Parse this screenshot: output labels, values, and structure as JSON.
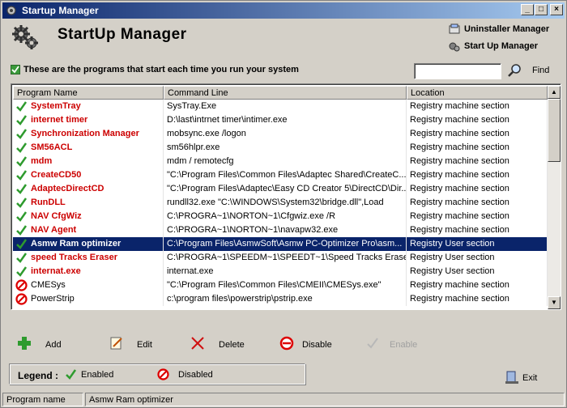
{
  "window": {
    "title": "Startup Manager"
  },
  "titlebar": {
    "minimize": "_",
    "maximize": "□",
    "close": "×"
  },
  "header": {
    "title": "StartUp Manager"
  },
  "nav": {
    "uninstaller": "Uninstaller Manager",
    "startup": "Start Up Manager"
  },
  "info": {
    "text": "These are the programs that start each time you run your system"
  },
  "search": {
    "value": "",
    "placeholder": "",
    "find_label": "Find"
  },
  "table": {
    "columns": [
      "Program Name",
      "Command Line",
      "Location"
    ],
    "rows": [
      {
        "name": "SystemTray",
        "command": "SysTray.Exe",
        "location": "Registry machine section",
        "status": "enabled"
      },
      {
        "name": "internet timer",
        "command": "D:\\last\\intrnet timer\\intimer.exe",
        "location": "Registry machine section",
        "status": "enabled"
      },
      {
        "name": "Synchronization Manager",
        "command": "mobsync.exe /logon",
        "location": "Registry machine section",
        "status": "enabled"
      },
      {
        "name": "SM56ACL",
        "command": "sm56hlpr.exe",
        "location": "Registry machine section",
        "status": "enabled"
      },
      {
        "name": "mdm",
        "command": "mdm / remotecfg",
        "location": "Registry machine section",
        "status": "enabled"
      },
      {
        "name": "CreateCD50",
        "command": "\"C:\\Program Files\\Common Files\\Adaptec Shared\\CreateC...",
        "location": "Registry machine section",
        "status": "enabled"
      },
      {
        "name": "AdaptecDirectCD",
        "command": "\"C:\\Program Files\\Adaptec\\Easy CD Creator 5\\DirectCD\\Dir...",
        "location": "Registry machine section",
        "status": "enabled"
      },
      {
        "name": "RunDLL",
        "command": "rundll32.exe \"C:\\WINDOWS\\System32\\bridge.dll\",Load",
        "location": "Registry machine section",
        "status": "enabled"
      },
      {
        "name": "NAV CfgWiz",
        "command": "C:\\PROGRA~1\\NORTON~1\\Cfgwiz.exe /R",
        "location": "Registry machine section",
        "status": "enabled"
      },
      {
        "name": "NAV Agent",
        "command": "C:\\PROGRA~1\\NORTON~1\\navapw32.exe",
        "location": "Registry machine section",
        "status": "enabled"
      },
      {
        "name": "Asmw Ram optimizer",
        "command": "C:\\Program Files\\AsmwSoft\\Asmw PC-Optimizer Pro\\asm...",
        "location": "Registry User section",
        "status": "enabled",
        "selected": true
      },
      {
        "name": "speed Tracks Eraser",
        "command": "C:\\PROGRA~1\\SPEEDM~1\\SPEEDT~1\\Speed Tracks Erase...",
        "location": "Registry User section",
        "status": "enabled"
      },
      {
        "name": "internat.exe",
        "command": "internat.exe",
        "location": "Registry User section",
        "status": "enabled"
      },
      {
        "name": "CMESys",
        "command": "\"C:\\Program Files\\Common Files\\CMEII\\CMESys.exe\"",
        "location": "Registry machine section",
        "status": "disabled"
      },
      {
        "name": "PowerStrip",
        "command": "c:\\program files\\powerstrip\\pstrip.exe",
        "location": "Registry machine section",
        "status": "disabled"
      }
    ]
  },
  "toolbar": {
    "add": "Add",
    "edit": "Edit",
    "delete": "Delete",
    "disable": "Disable",
    "enable": "Enable"
  },
  "legend": {
    "title": "Legend :",
    "enabled": "Enabled",
    "disabled": "Disabled"
  },
  "exit": {
    "label": "Exit"
  },
  "status": {
    "label": "Program name",
    "value": "Asmw Ram optimizer"
  },
  "colors": {
    "title_start": "#0a246a",
    "title_end": "#a6caf0",
    "enabled_text": "#cc0000",
    "selection": "#0a246a",
    "check_green": "#2e9b2e",
    "disabled_red": "#dd0000"
  },
  "icons": {
    "enabled": "check-icon",
    "disabled": "disabled-icon"
  }
}
